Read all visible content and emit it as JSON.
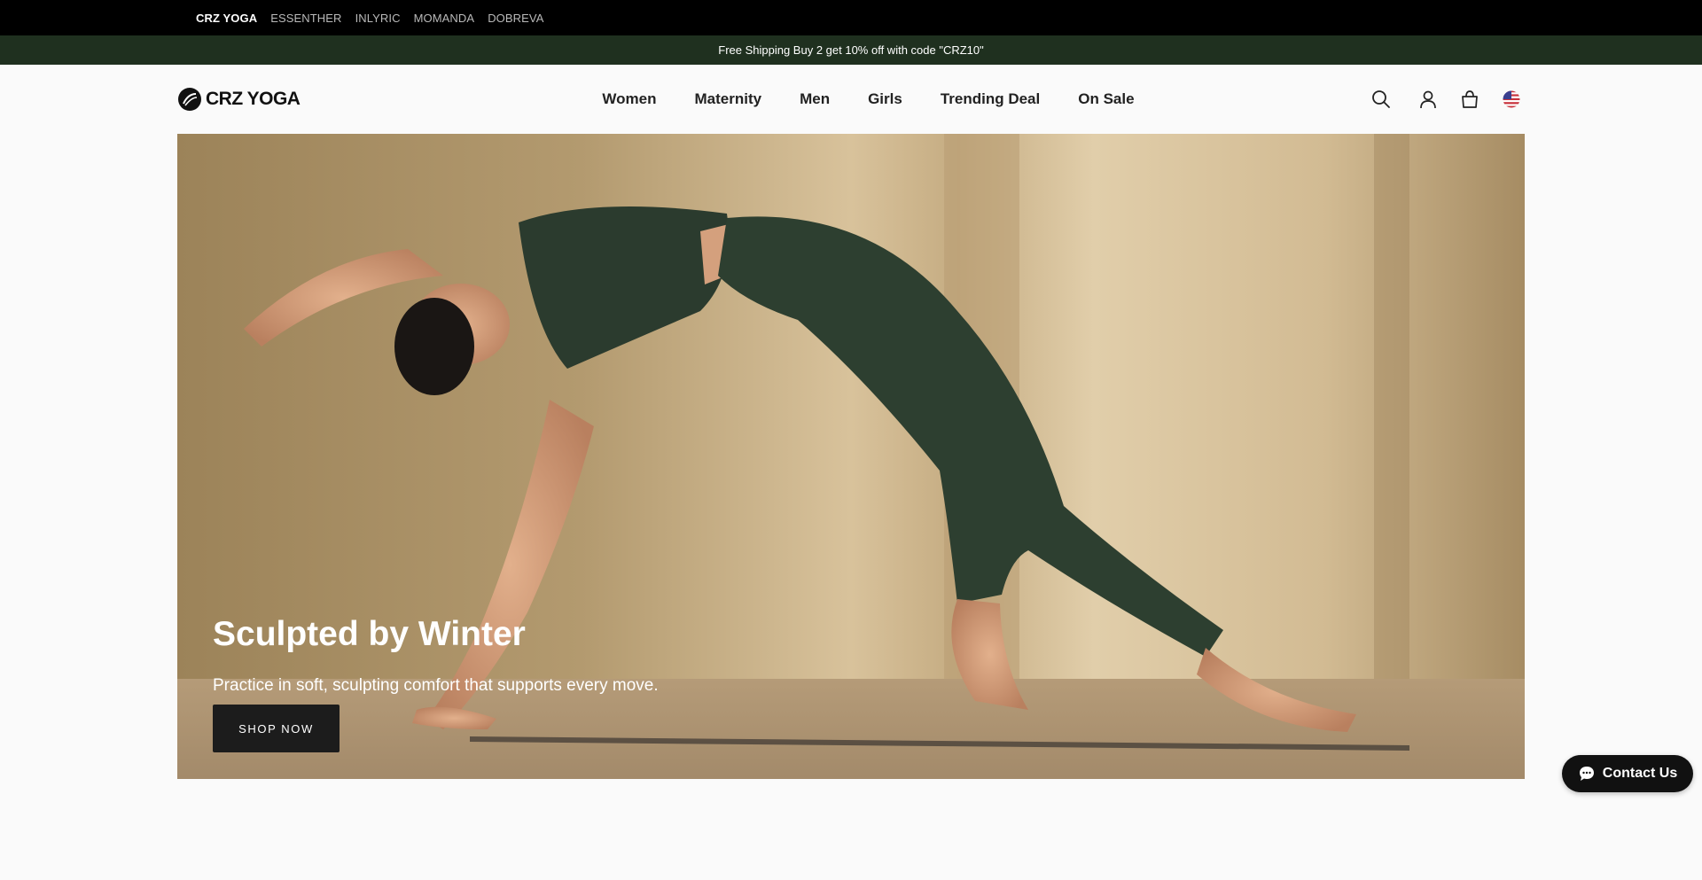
{
  "brand_bar": {
    "brands": [
      {
        "label": "CRZ YOGA",
        "active": true
      },
      {
        "label": "ESSENTHER",
        "active": false
      },
      {
        "label": "INLYRIC",
        "active": false
      },
      {
        "label": "MOMANDA",
        "active": false
      },
      {
        "label": "DOBREVA",
        "active": false
      }
    ]
  },
  "announcement": {
    "text": "Free Shipping  Buy 2 get 10% off with code \"CRZ10\""
  },
  "header": {
    "logo_text": "CRZ YOGA",
    "nav": [
      "Women",
      "Maternity",
      "Men",
      "Girls",
      "Trending Deal",
      "On Sale"
    ],
    "icons": [
      "search-icon",
      "account-icon",
      "cart-icon",
      "us-flag-icon"
    ]
  },
  "hero": {
    "title": "Sculpted by Winter",
    "subtitle": "Practice in soft, sculpting comfort that supports every move.",
    "button_label": "SHOP NOW"
  },
  "contact_widget": {
    "label": "Contact Us",
    "icon": "chat-bubble-icon"
  },
  "colors": {
    "announcement_bg": "#1f301f",
    "brand_bar_bg": "#000000",
    "button_bg": "#1c1c1c",
    "page_bg": "#fafafa"
  }
}
